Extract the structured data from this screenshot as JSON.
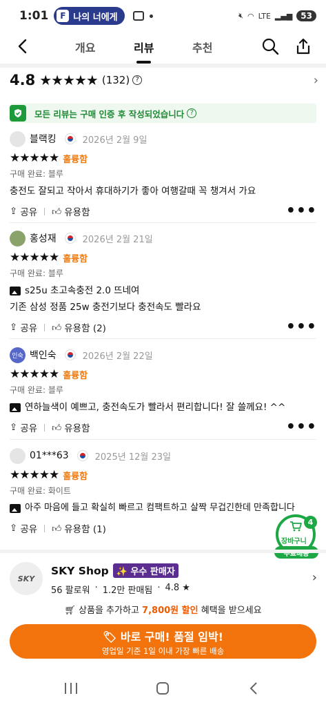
{
  "status": {
    "time": "1:01",
    "pill_label": "나의 너에게",
    "battery": "53"
  },
  "nav": {
    "tabs": [
      "개요",
      "리뷰",
      "추천"
    ],
    "active_tab": 1
  },
  "summary": {
    "score": "4.8",
    "stars": "★★★★★",
    "count": "(132)"
  },
  "verified_text": "모든 리뷰는 구매 인증 후 작성되었습니다",
  "reviews": [
    {
      "name": "블랙킹",
      "date": "2026년 2월 9일",
      "stars": "★★★★★",
      "grade": "훌륭함",
      "option": "구매 완료: 블루",
      "lines": [
        "충전도 잘되고 작아서 휴대하기가 좋아 여행갈때 꼭 챙겨서 가요"
      ],
      "share": "공유",
      "helpful": "유용함"
    },
    {
      "name": "홍성재",
      "date": "2026년 2월 21일",
      "stars": "★★★★★",
      "grade": "훌륭함",
      "option": "구매 완료: 블루",
      "lines": [
        "s25u 초고속충전 2.0 뜨네여",
        "기존 삼성 정품 25w 충전기보다 충전속도 빨라요"
      ],
      "share": "공유",
      "helpful": "유용함 (2)"
    },
    {
      "name": "백인숙",
      "avatar_text": "인숙",
      "date": "2026년 2월 22일",
      "stars": "★★★★★",
      "grade": "훌륭함",
      "option": "구매 완료: 블루",
      "lines": [
        "연하늘색이 예쁘고, 충전속도가 빨라서 편리합니다! 잘 쓸께요! ^^"
      ],
      "share": "공유",
      "helpful": "유용함"
    },
    {
      "name": "01***63",
      "date": "2025년 12월 23일",
      "stars": "★★★★★",
      "grade": "훌륭함",
      "option": "구매 완료: 화이트",
      "lines": [
        "아주 마음에 들고 확실히 빠르고 컴팩트하고 살짝 무겁긴한데 만족합니다"
      ],
      "share": "공유",
      "helpful": "유용함 (1)"
    }
  ],
  "cart": {
    "badge": "4",
    "label": "장바구니",
    "free": "무료배송"
  },
  "shop": {
    "logo": "SKY",
    "name": "SKY Shop",
    "badge": "우수 판매자",
    "followers": "56 팔로워",
    "sold": "1.2만 판매됨",
    "rating": "4.8 ★"
  },
  "promo": {
    "pre": "상품을 추가하고",
    "highlight": "7,800원 할인",
    "post": "혜택을 받으세요"
  },
  "buy": {
    "title": "바로 구매! 품절 임박!",
    "subtitle": "영업일 기준 1일 이내 가장 빠른 배송"
  },
  "colors": {
    "accent": "#f2720c",
    "green": "#1ea845",
    "seller": "#5c2d91"
  }
}
